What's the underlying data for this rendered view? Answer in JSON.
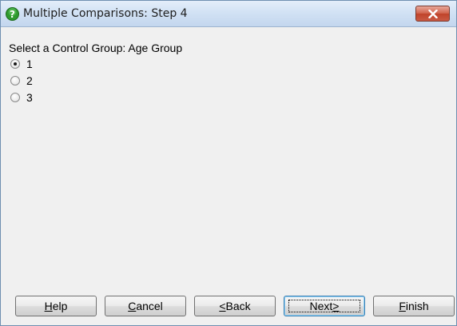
{
  "window": {
    "title": "Multiple Comparisons: Step 4",
    "title_icon": "question-mark-icon",
    "close_icon": "close-icon"
  },
  "prompt": {
    "label": "Select a Control Group: Age Group"
  },
  "options": [
    {
      "label": "1",
      "checked": true
    },
    {
      "label": "2",
      "checked": false
    },
    {
      "label": "3",
      "checked": false
    }
  ],
  "buttons": {
    "help": {
      "pre": "",
      "mnemonic": "H",
      "post": "elp"
    },
    "cancel": {
      "pre": "",
      "mnemonic": "C",
      "post": "ancel"
    },
    "back": {
      "pre": "",
      "mnemonic": "<",
      "post": " Back"
    },
    "next": {
      "pre": "Next ",
      "mnemonic": ">",
      "post": ""
    },
    "finish": {
      "pre": "",
      "mnemonic": "F",
      "post": "inish"
    }
  },
  "colors": {
    "icon_green": "#2e9a2e",
    "close_red": "#c9452c"
  }
}
